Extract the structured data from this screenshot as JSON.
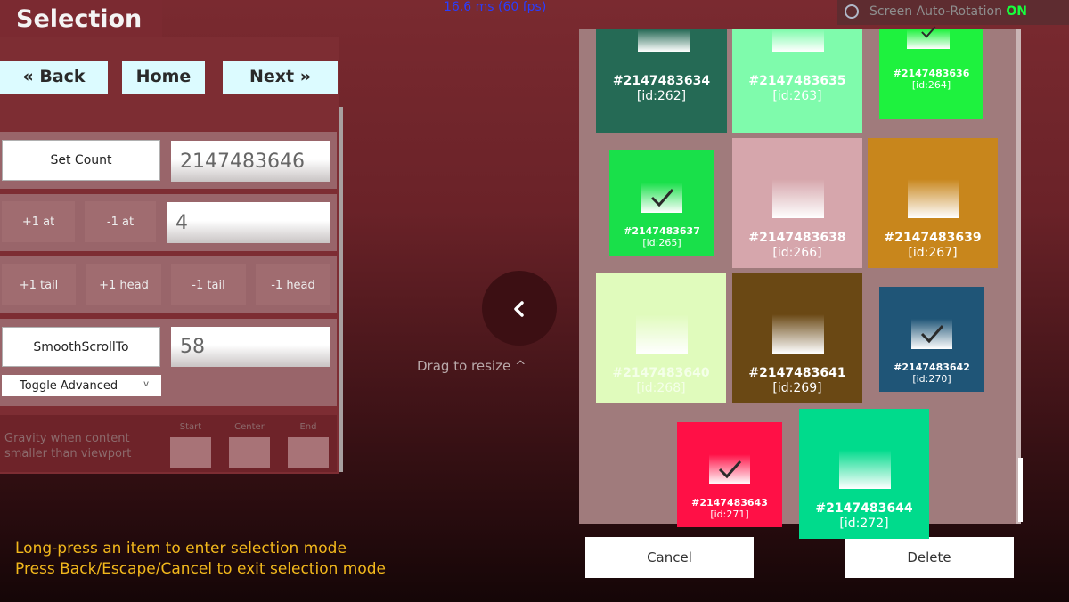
{
  "header": {
    "title": "Selection",
    "fps": "16.6 ms (60 fps)",
    "rotation_label": "Screen Auto-Rotation",
    "rotation_state": "ON"
  },
  "nav": {
    "back": "« Back",
    "home": "Home",
    "next": "Next »"
  },
  "controls": {
    "set_count_label": "Set Count",
    "count_value": "2147483646",
    "plus_one_at": "+1 at",
    "minus_one_at": "-1 at",
    "at_value": "4",
    "plus_one_tail": "+1 tail",
    "plus_one_head": "+1 head",
    "minus_one_tail": "-1 tail",
    "minus_one_head": "-1 head",
    "smooth_scroll_label": "SmoothScrollTo",
    "scroll_value": "58",
    "toggle_advanced": "Toggle Advanced",
    "toggle_chevron": "v",
    "gravity_label": "Gravity when content smaller than viewport",
    "gravity_options": [
      "Start",
      "Center",
      "End"
    ]
  },
  "hints": [
    "Long-press an item to enter selection mode",
    "Press Back/Escape/Cancel to exit selection mode"
  ],
  "center": {
    "resize_icon": "chevron-left-icon",
    "drag_label": "Drag to resize ^"
  },
  "items": [
    {
      "label": "#2147483634",
      "id": "[id:262]",
      "color": "#256a55",
      "text": "#ffffff",
      "checked": false
    },
    {
      "label": "#2147483635",
      "id": "[id:263]",
      "color": "#7ffbac",
      "text": "#ffffff",
      "checked": false
    },
    {
      "label": "#2147483636",
      "id": "[id:264]",
      "color": "#1ef23e",
      "text": "#ffffff",
      "checked": true
    },
    {
      "label": "#2147483637",
      "id": "[id:265]",
      "color": "#19e04a",
      "text": "#ffffff",
      "checked": true
    },
    {
      "label": "#2147483638",
      "id": "[id:266]",
      "color": "#d6a6ac",
      "text": "#ffffff",
      "checked": false
    },
    {
      "label": "#2147483639",
      "id": "[id:267]",
      "color": "#c8861c",
      "text": "#ffffff",
      "checked": false
    },
    {
      "label": "#2147483640",
      "id": "[id:268]",
      "color": "#e0fbbc",
      "text": "#f4ffe8",
      "checked": false
    },
    {
      "label": "#2147483641",
      "id": "[id:269]",
      "color": "#6a4814",
      "text": "#ffffff",
      "checked": false
    },
    {
      "label": "#2147483642",
      "id": "[id:270]",
      "color": "#1f5577",
      "text": "#ffffff",
      "checked": true
    },
    {
      "label": "#2147483643",
      "id": "[id:271]",
      "color": "#ff1046",
      "text": "#ffffff",
      "checked": true
    },
    {
      "label": "#2147483644",
      "id": "[id:272]",
      "color": "#00db8c",
      "text": "#ffffff",
      "checked": false
    }
  ],
  "actions": {
    "cancel": "Cancel",
    "delete": "Delete"
  }
}
